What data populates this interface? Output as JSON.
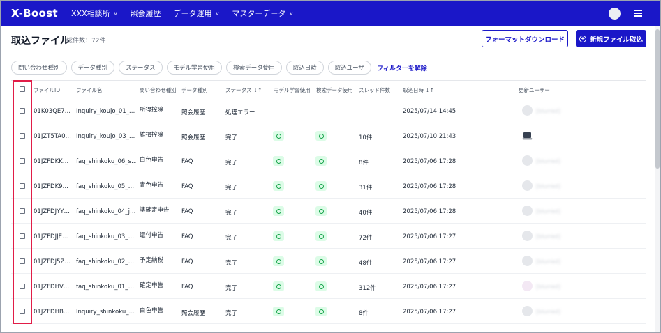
{
  "nav": {
    "logo": "X-Boost",
    "items": [
      {
        "label": "XXX相談所",
        "has_dropdown": true
      },
      {
        "label": "照会履歴",
        "has_dropdown": false
      },
      {
        "label": "データ運用",
        "has_dropdown": true
      },
      {
        "label": "マスターデータ",
        "has_dropdown": true
      }
    ]
  },
  "header": {
    "title": "取込ファイル",
    "total_count": "総件数：72件",
    "format_download_label": "フォーマットダウンロード",
    "new_import_label": "新規ファイル取込"
  },
  "filters": {
    "chips": [
      "問い合わせ種別",
      "データ種別",
      "ステータス",
      "モデル学習使用",
      "検索データ使用",
      "取込日時",
      "取込ユーザ"
    ],
    "clear_label": "フィルターを解除"
  },
  "table": {
    "columns": {
      "file_id": "ファイルID",
      "file_name": "ファイル名",
      "inquiry_type": "問い合わせ種別",
      "data_type": "データ種別",
      "status": "ステータス ↓↑",
      "model_training": "モデル学習使用",
      "search_data": "検索データ使用",
      "thread_count": "スレッド件数",
      "import_date": "取込日時 ↓↑",
      "updated_user": "更新ユーザー"
    },
    "rows": [
      {
        "file_id": "01K03QE7…",
        "file_name": "Inquiry_koujo_01_…",
        "inquiry_type": "所得控除",
        "data_type": "照会履歴",
        "status": "処理エラー",
        "model": false,
        "search": false,
        "threads": "",
        "date": "2025/07/14 14:45",
        "avatar": "blank",
        "user": "[blurred]"
      },
      {
        "file_id": "01JZT5TA0…",
        "file_name": "Inquiry_koujo_03_…",
        "inquiry_type": "雑損控除",
        "data_type": "照会履歴",
        "status": "完了",
        "model": true,
        "search": true,
        "threads": "10件",
        "date": "2025/07/10 21:43",
        "avatar": "laptop",
        "user": ""
      },
      {
        "file_id": "01JZFDKK…",
        "file_name": "faq_shinkoku_06_s…",
        "inquiry_type": "白色申告",
        "data_type": "FAQ",
        "status": "完了",
        "model": true,
        "search": true,
        "threads": "8件",
        "date": "2025/07/06 17:28",
        "avatar": "blank",
        "user": "[blurred]"
      },
      {
        "file_id": "01JZFDK9…",
        "file_name": "faq_shinkoku_05_…",
        "inquiry_type": "青色申告",
        "data_type": "FAQ",
        "status": "完了",
        "model": true,
        "search": true,
        "threads": "31件",
        "date": "2025/07/06 17:28",
        "avatar": "blank",
        "user": "[blurred]"
      },
      {
        "file_id": "01JZFDJYY…",
        "file_name": "faq_shinkoku_04_j…",
        "inquiry_type": "準確定申告",
        "data_type": "FAQ",
        "status": "完了",
        "model": true,
        "search": true,
        "threads": "40件",
        "date": "2025/07/06 17:28",
        "avatar": "blank",
        "user": "[blurred]"
      },
      {
        "file_id": "01JZFDJJE…",
        "file_name": "faq_shinkoku_03_…",
        "inquiry_type": "還付申告",
        "data_type": "FAQ",
        "status": "完了",
        "model": true,
        "search": true,
        "threads": "72件",
        "date": "2025/07/06 17:27",
        "avatar": "blank",
        "user": "[blurred]"
      },
      {
        "file_id": "01JZFDJ5Z…",
        "file_name": "faq_shinkoku_02_…",
        "inquiry_type": "予定納税",
        "data_type": "FAQ",
        "status": "完了",
        "model": true,
        "search": true,
        "threads": "48件",
        "date": "2025/07/06 17:27",
        "avatar": "blank",
        "user": "[blurred]"
      },
      {
        "file_id": "01JZFDHV…",
        "file_name": "faq_shinkoku_01_…",
        "inquiry_type": "確定申告",
        "data_type": "FAQ",
        "status": "完了",
        "model": true,
        "search": true,
        "threads": "312件",
        "date": "2025/07/06 17:27",
        "avatar": "photo",
        "user": "[blurred]"
      },
      {
        "file_id": "01JZFDHB…",
        "file_name": "Inquiry_shinkoku_…",
        "inquiry_type": "白色申告",
        "data_type": "照会履歴",
        "status": "完了",
        "model": true,
        "search": true,
        "threads": "8件",
        "date": "2025/07/06 17:27",
        "avatar": "blank",
        "user": "[blurred]"
      }
    ]
  },
  "colors": {
    "brand": "#1a17c8",
    "success_bg": "#dcfce7",
    "success_fg": "#16a34a",
    "highlight": "#e11d48"
  }
}
